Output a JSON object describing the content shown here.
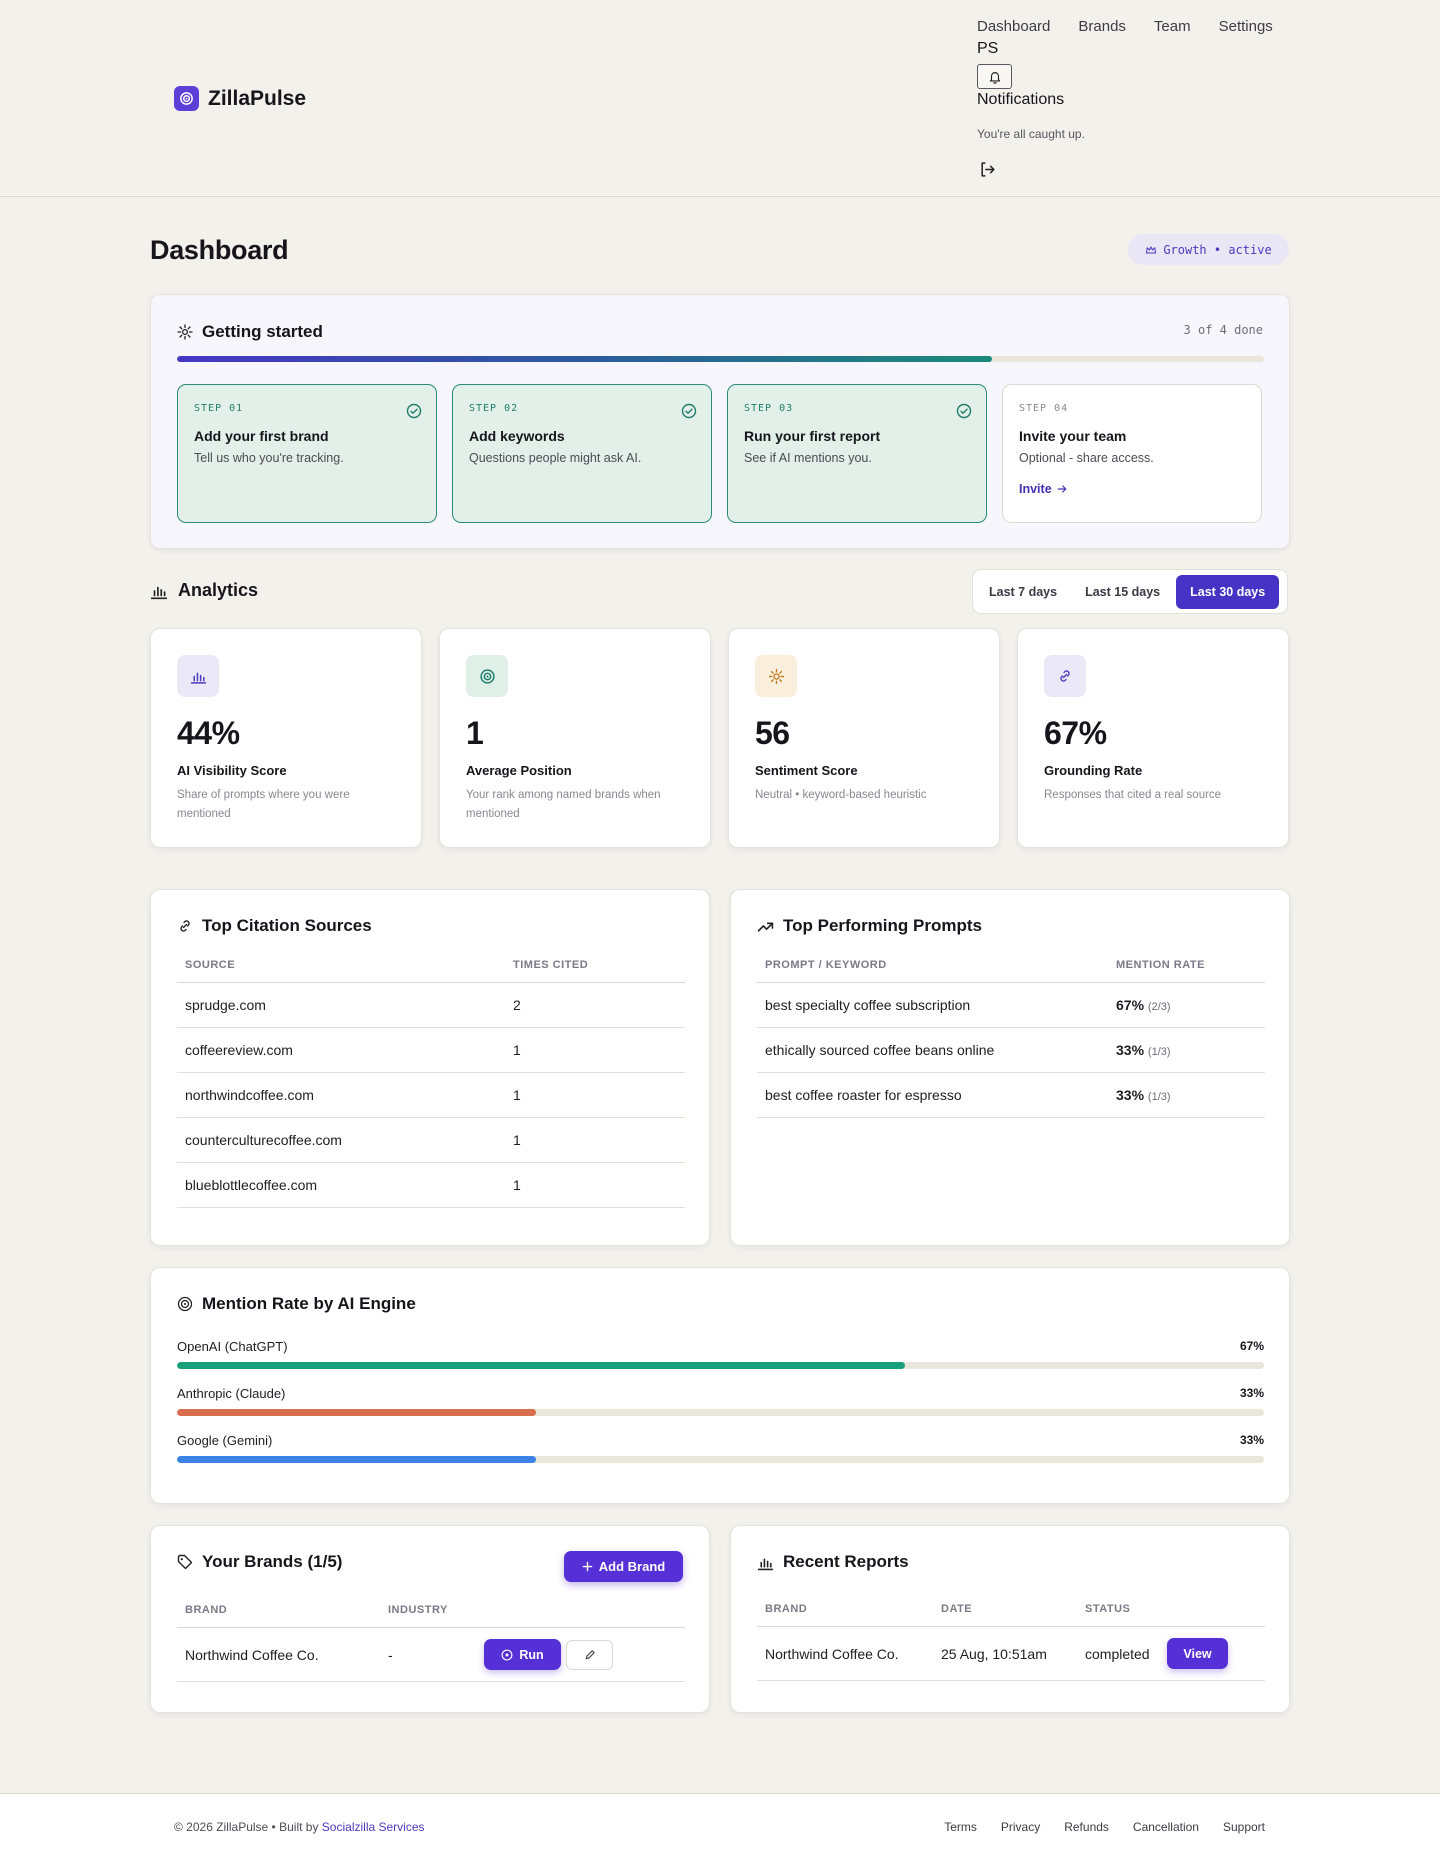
{
  "header": {
    "brand": "ZillaPulse",
    "nav": [
      "Dashboard",
      "Brands",
      "Team",
      "Settings"
    ],
    "user_initials": "PS",
    "notifications_title": "Notifications",
    "notifications_empty": "You're all caught up."
  },
  "page": {
    "title": "Dashboard",
    "plan_badge": "Growth • active"
  },
  "getting_started": {
    "title": "Getting started",
    "count_label": "3 of 4 done",
    "progress": 0.75,
    "steps": [
      {
        "num": "STEP 01",
        "title": "Add your first brand",
        "desc": "Tell us who you're tracking.",
        "done": true
      },
      {
        "num": "STEP 02",
        "title": "Add keywords",
        "desc": "Questions people might ask AI.",
        "done": true
      },
      {
        "num": "STEP 03",
        "title": "Run your first report",
        "desc": "See if AI mentions you.",
        "done": true
      },
      {
        "num": "STEP 04",
        "title": "Invite your team",
        "desc": "Optional - share access.",
        "done": false,
        "link": "Invite"
      }
    ]
  },
  "analytics": {
    "title": "Analytics",
    "ranges": [
      "Last 7 days",
      "Last 15 days",
      "Last 30 days"
    ],
    "active_range": "Last 30 days",
    "metrics": [
      {
        "value": "44%",
        "label": "AI Visibility Score",
        "desc": "Share of prompts where you were mentioned",
        "icon": "bar-chart-icon"
      },
      {
        "value": "1",
        "label": "Average Position",
        "desc": "Your rank among named brands when mentioned",
        "icon": "target-icon"
      },
      {
        "value": "56",
        "label": "Sentiment Score",
        "desc": "Neutral • keyword-based heuristic",
        "icon": "sun-icon"
      },
      {
        "value": "67%",
        "label": "Grounding Rate",
        "desc": "Responses that cited a real source",
        "icon": "link-icon"
      }
    ]
  },
  "citations": {
    "title": "Top Citation Sources",
    "columns": [
      "SOURCE",
      "TIMES CITED"
    ],
    "rows": [
      [
        "sprudge.com",
        "2"
      ],
      [
        "coffeereview.com",
        "1"
      ],
      [
        "northwindcoffee.com",
        "1"
      ],
      [
        "counterculturecoffee.com",
        "1"
      ],
      [
        "blueblottlecoffee.com",
        "1"
      ]
    ]
  },
  "prompts": {
    "title": "Top Performing Prompts",
    "columns": [
      "PROMPT / KEYWORD",
      "MENTION RATE"
    ],
    "rows": [
      {
        "prompt": "best specialty coffee subscription",
        "rate": "67%",
        "detail": "(2/3)"
      },
      {
        "prompt": "ethically sourced coffee beans online",
        "rate": "33%",
        "detail": "(1/3)"
      },
      {
        "prompt": "best coffee roaster for espresso",
        "rate": "33%",
        "detail": "(1/3)"
      }
    ]
  },
  "mention_rate": {
    "title": "Mention Rate by AI Engine",
    "engines": [
      {
        "name": "OpenAI (ChatGPT)",
        "pct_label": "67%",
        "value": 0.67,
        "color": "#17a07a"
      },
      {
        "name": "Anthropic (Claude)",
        "pct_label": "33%",
        "value": 0.33,
        "color": "#d86e4e"
      },
      {
        "name": "Google (Gemini)",
        "pct_label": "33%",
        "value": 0.33,
        "color": "#3b82e6"
      }
    ]
  },
  "brands": {
    "title": "Your Brands (1/5)",
    "add_label": "Add Brand",
    "columns": [
      "BRAND",
      "INDUSTRY"
    ],
    "rows": [
      {
        "brand": "Northwind Coffee Co.",
        "industry": "-",
        "run_label": "Run"
      }
    ]
  },
  "reports": {
    "title": "Recent Reports",
    "columns": [
      "BRAND",
      "DATE",
      "STATUS"
    ],
    "rows": [
      {
        "brand": "Northwind Coffee Co.",
        "date": "25 Aug, 10:51am",
        "status": "completed",
        "action": "View"
      }
    ]
  },
  "footer": {
    "copyright": "© 2026 ZillaPulse • Built by",
    "builder": "Socialzilla Services",
    "links": [
      "Terms",
      "Privacy",
      "Refunds",
      "Cancellation",
      "Support"
    ]
  },
  "colors": {
    "accent": "#4633c6",
    "success": "#1f7e6b",
    "background": "#f3f1ec"
  }
}
